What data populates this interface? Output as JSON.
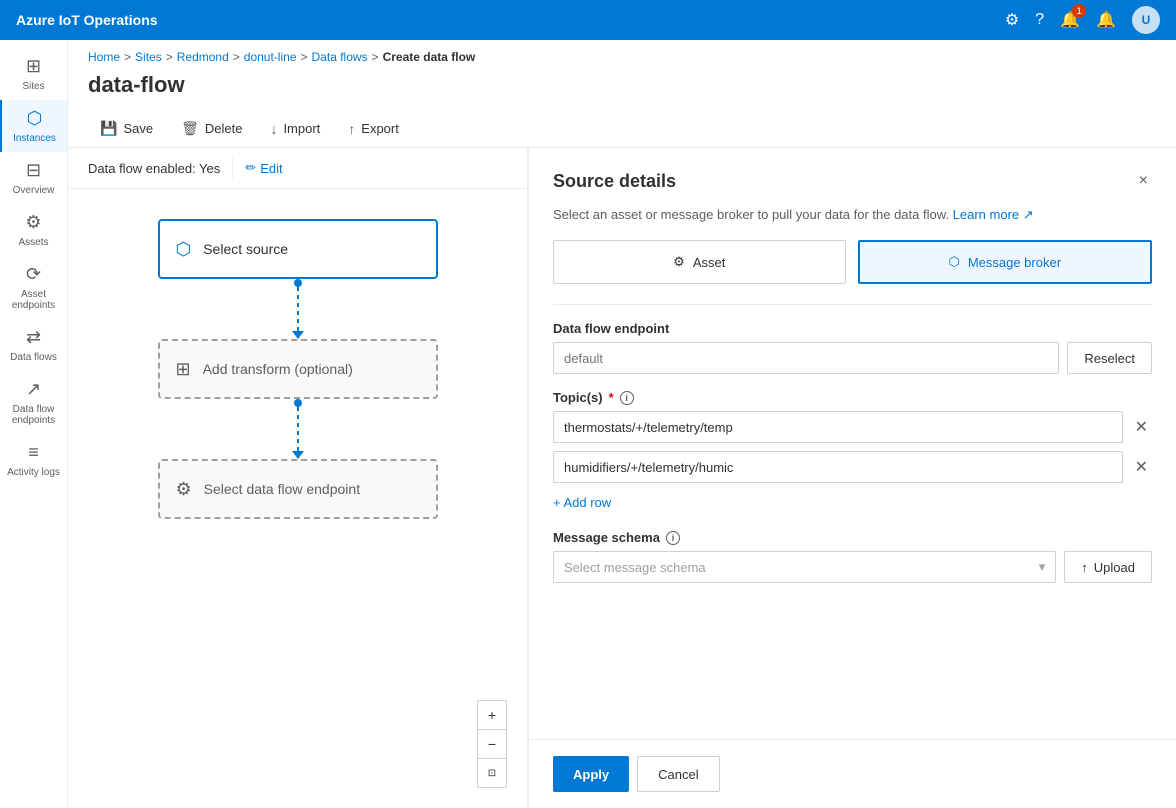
{
  "app": {
    "title": "Azure IoT Operations"
  },
  "breadcrumb": {
    "items": [
      "Home",
      "Sites",
      "Redmond",
      "donut-line",
      "Data flows",
      "Create data flow"
    ]
  },
  "page": {
    "title": "data-flow"
  },
  "toolbar": {
    "save_label": "Save",
    "delete_label": "Delete",
    "import_label": "Import",
    "export_label": "Export"
  },
  "dataflow_status": {
    "label": "Data flow enabled: Yes"
  },
  "edit_label": "Edit",
  "canvas": {
    "nodes": [
      {
        "label": "Select source"
      },
      {
        "label": "Add transform (optional)"
      },
      {
        "label": "Select data flow endpoint"
      }
    ]
  },
  "panel": {
    "title": "Source details",
    "subtitle": "Select an asset or message broker to pull your data for the data flow.",
    "learn_more": "Learn more",
    "close_label": "×",
    "source_type": {
      "asset_label": "Asset",
      "broker_label": "Message broker"
    },
    "endpoint": {
      "label": "Data flow endpoint",
      "placeholder": "default",
      "reselect_label": "Reselect"
    },
    "topics": {
      "label": "Topic(s)",
      "values": [
        "thermostats/+/telemetry/temp",
        "humidifiers/+/telemetry/humic"
      ],
      "add_row_label": "+ Add row"
    },
    "schema": {
      "label": "Message schema",
      "placeholder": "Select message schema",
      "upload_label": "Upload"
    },
    "apply_label": "Apply",
    "cancel_label": "Cancel"
  },
  "sidebar": {
    "items": [
      {
        "label": "Sites",
        "icon": "⊞"
      },
      {
        "label": "Instances",
        "icon": "⬡"
      },
      {
        "label": "Overview",
        "icon": "⊟"
      },
      {
        "label": "Assets",
        "icon": "⚙"
      },
      {
        "label": "Asset endpoints",
        "icon": "⟳"
      },
      {
        "label": "Data flows",
        "icon": "⇄"
      },
      {
        "label": "Data flow endpoints",
        "icon": "↗"
      },
      {
        "label": "Activity logs",
        "icon": "≡"
      }
    ]
  },
  "colors": {
    "accent": "#0078d4",
    "active_bg": "#f0f6ff"
  }
}
